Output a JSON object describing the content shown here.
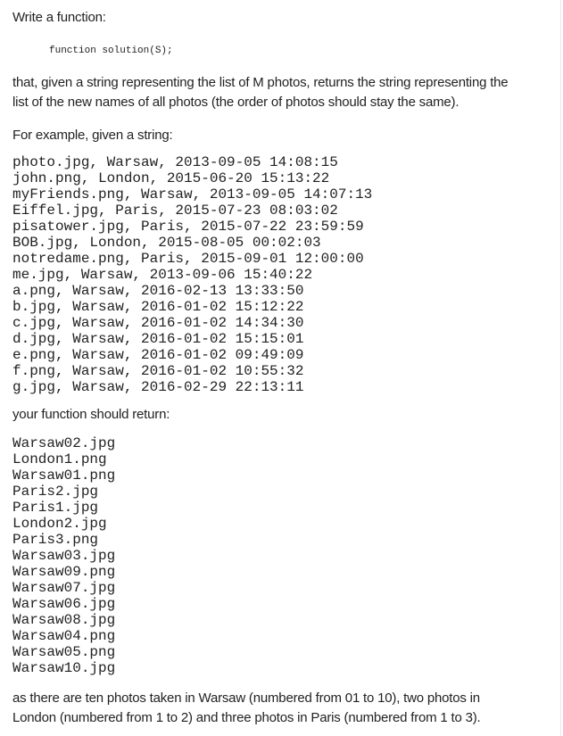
{
  "intro": "Write a function:",
  "signature": "function solution(S);",
  "description": [
    "that, given a string representing the list of M photos, returns the string representing the",
    "list of the new names of all photos (the order of photos should stay the same)."
  ],
  "example_label": "For example, given a string:",
  "input_lines": [
    "photo.jpg, Warsaw, 2013-09-05 14:08:15",
    "john.png, London, 2015-06-20 15:13:22",
    "myFriends.png, Warsaw, 2013-09-05 14:07:13",
    "Eiffel.jpg, Paris, 2015-07-23 08:03:02",
    "pisatower.jpg, Paris, 2015-07-22 23:59:59",
    "BOB.jpg, London, 2015-08-05 00:02:03",
    "notredame.png, Paris, 2015-09-01 12:00:00",
    "me.jpg, Warsaw, 2013-09-06 15:40:22",
    "a.png, Warsaw, 2016-02-13 13:33:50",
    "b.jpg, Warsaw, 2016-01-02 15:12:22",
    "c.jpg, Warsaw, 2016-01-02 14:34:30",
    "d.jpg, Warsaw, 2016-01-02 15:15:01",
    "e.png, Warsaw, 2016-01-02 09:49:09",
    "f.png, Warsaw, 2016-01-02 10:55:32",
    "g.jpg, Warsaw, 2016-02-29 22:13:11"
  ],
  "return_label": "your function should return:",
  "output_lines": [
    "Warsaw02.jpg",
    "London1.png",
    "Warsaw01.png",
    "Paris2.jpg",
    "Paris1.jpg",
    "London2.jpg",
    "Paris3.png",
    "Warsaw03.jpg",
    "Warsaw09.png",
    "Warsaw07.jpg",
    "Warsaw06.jpg",
    "Warsaw08.jpg",
    "Warsaw04.png",
    "Warsaw05.png",
    "Warsaw10.jpg"
  ],
  "explanation": [
    "as there are ten photos taken in Warsaw (numbered from 01 to 10), two photos in",
    "London (numbered from 1 to 2) and three photos in Paris (numbered from 1 to 3)."
  ]
}
